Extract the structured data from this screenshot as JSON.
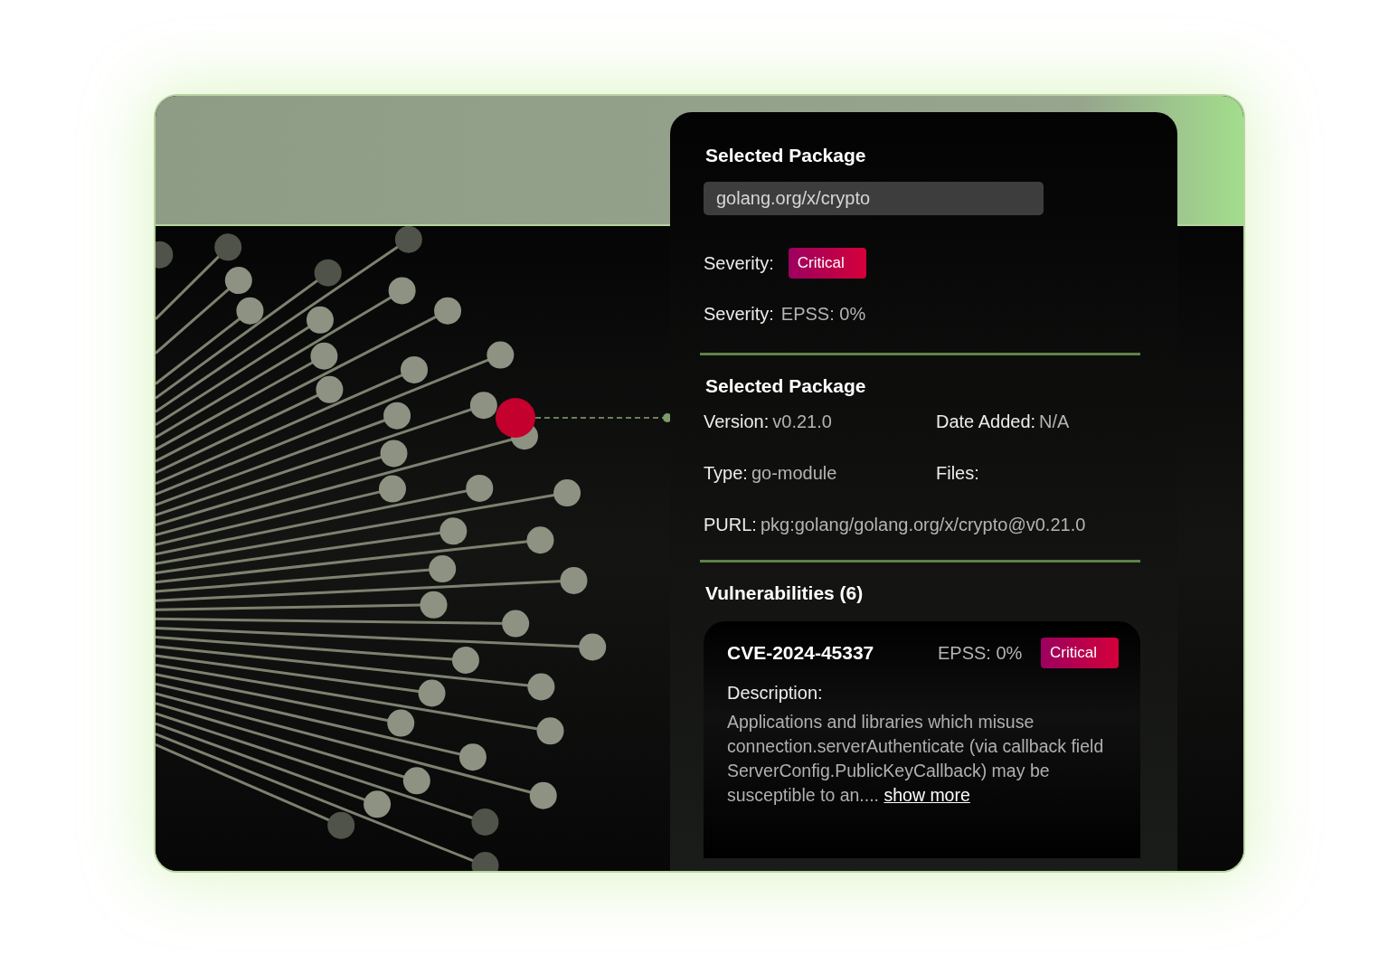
{
  "panel": {
    "title": "Selected Package",
    "package_field": {
      "value": "golang.org/x/crypto"
    },
    "severity": {
      "label": "Severity:",
      "badge": {
        "text": "Critical",
        "kind": "critical"
      }
    },
    "epss": {
      "label": "Severity:",
      "value": "EPSS: 0%"
    },
    "details_heading": "Selected Package",
    "details": [
      {
        "label": "Version:",
        "value": "v0.21.0"
      },
      {
        "label": "Date Added:",
        "value": "N/A"
      },
      {
        "label": "Type:",
        "value": "go-module"
      },
      {
        "label": "Files:"
      }
    ],
    "purl": {
      "label": "PURL:",
      "value": "pkg:golang/golang.org/x/crypto@v0.21.0"
    },
    "vulnerabilities": {
      "heading": "Vulnerabilities (6)",
      "items": [
        {
          "id": "CVE-2024-45337",
          "epss": "EPSS: 0%",
          "badge": {
            "text": "Critical",
            "kind": "critical"
          },
          "description_label": "Description:",
          "description": "Applications and libraries which misuse connection.serverAuthenticate (via callback field ServerConfig.PublicKeyCallback) may be susceptible to an....",
          "link": "show more"
        }
      ]
    }
  }
}
